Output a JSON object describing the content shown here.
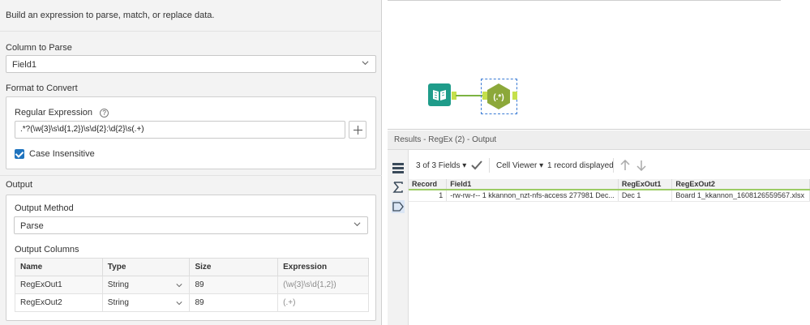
{
  "config": {
    "intro": "Build an expression to parse, match, or replace data.",
    "column_to_parse": {
      "title": "Column to Parse",
      "value": "Field1"
    },
    "format_to_convert": {
      "title": "Format to Convert",
      "regex_label": "Regular Expression",
      "help_icon": "?",
      "regex_value": ".*?(\\w{3}\\s\\d{1,2})\\s\\d{2}:\\d{2}\\s(.+)",
      "case_insensitive_label": "Case Insensitive",
      "case_insensitive": true
    },
    "output": {
      "title": "Output",
      "method_label": "Output Method",
      "method_value": "Parse",
      "columns_label": "Output Columns",
      "headers": [
        "Name",
        "Type",
        "Size",
        "Expression"
      ],
      "rows": [
        {
          "name": "RegExOut1",
          "type": "String",
          "size": "89",
          "expression": "(\\w{3}\\s\\d{1,2})"
        },
        {
          "name": "RegExOut2",
          "type": "String",
          "size": "89",
          "expression": "(.+)"
        }
      ]
    }
  },
  "canvas": {
    "regex_node_label": "(.*)"
  },
  "results": {
    "header": "Results - RegEx (2) - Output",
    "fields_label": "3 of 3 Fields",
    "viewer_label": "Cell Viewer",
    "records_label": "1 record displayed",
    "columns": [
      "Record",
      "Field1",
      "RegExOut1",
      "RegExOut2"
    ],
    "rows": [
      [
        "1",
        "-rw-rw-r-- 1 kkannon_nzt-nfs-access 277981 Dec...",
        "Dec 1",
        "Board 1_kkannon_1608126559567.xlsx"
      ]
    ]
  },
  "colors": {
    "accent": "#1e73be",
    "tool_teal": "#1f9c8a",
    "tool_green": "#8ca83a",
    "connection": "#7cb342"
  },
  "icons": [
    "chevron-down-icon",
    "help-icon",
    "plus-icon",
    "checkbox-icon",
    "input-book-icon",
    "regex-hex-icon",
    "table-view-icon",
    "sigma-icon",
    "tag-icon",
    "checkmark-icon",
    "arrow-up-icon",
    "arrow-down-icon"
  ]
}
